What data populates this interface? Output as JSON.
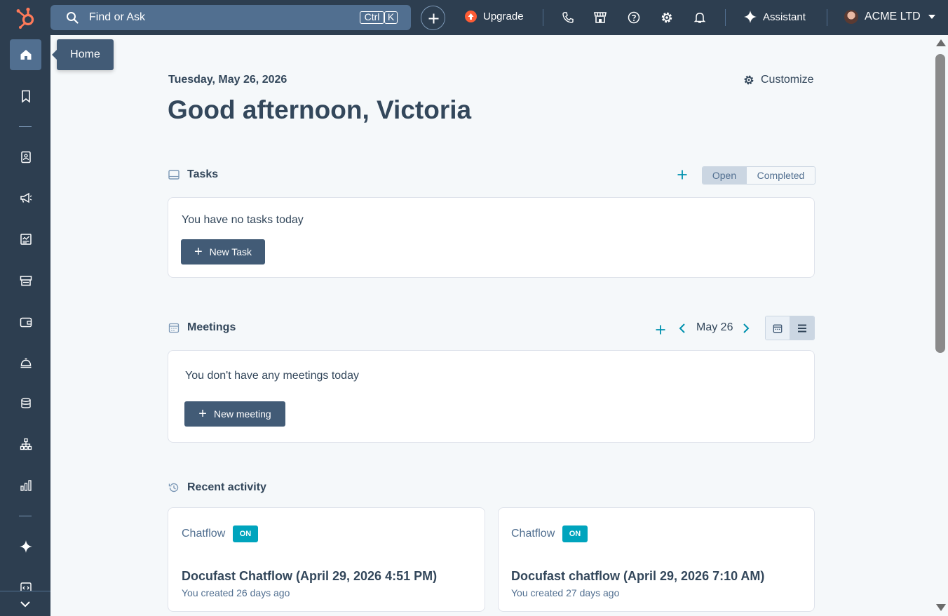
{
  "topbar": {
    "search_placeholder": "Find or Ask",
    "shortcut_ctrl": "Ctrl",
    "shortcut_k": "K",
    "upgrade_label": "Upgrade",
    "assistant_label": "Assistant",
    "account_name": "ACME LTD"
  },
  "sidebar": {
    "items": [
      "home",
      "bookmarks",
      "contacts",
      "marketing",
      "content",
      "commerce",
      "payments",
      "service",
      "data-management",
      "automation",
      "reporting",
      "breeze",
      "development"
    ],
    "tooltip": "Home"
  },
  "main": {
    "date": "Tuesday, May 26, 2026",
    "customize_label": "Customize",
    "greeting": "Good afternoon, Victoria",
    "tasks": {
      "title": "Tasks",
      "tab_open": "Open",
      "tab_completed": "Completed",
      "empty_text": "You have no tasks today",
      "new_button": "New Task"
    },
    "meetings": {
      "title": "Meetings",
      "current_date": "May 26",
      "empty_text": "You don't have any meetings today",
      "new_button": "New meeting"
    },
    "recent_activity": {
      "title": "Recent activity",
      "cards": [
        {
          "type": "Chatflow",
          "status": "ON",
          "title": "Docufast Chatflow (April 29, 2026 4:51 PM)",
          "subtitle": "You created 26 days ago"
        },
        {
          "type": "Chatflow",
          "status": "ON",
          "title": "Docufast chatflow (April 29, 2026 7:10 AM)",
          "subtitle": "You created 27 days ago"
        }
      ]
    }
  },
  "colors": {
    "nav_bg": "#2d3e50",
    "accent_teal": "#00a4bd",
    "link_teal": "#0091ae",
    "upgrade_orange": "#ff5c35",
    "button_dark": "#425b76"
  }
}
